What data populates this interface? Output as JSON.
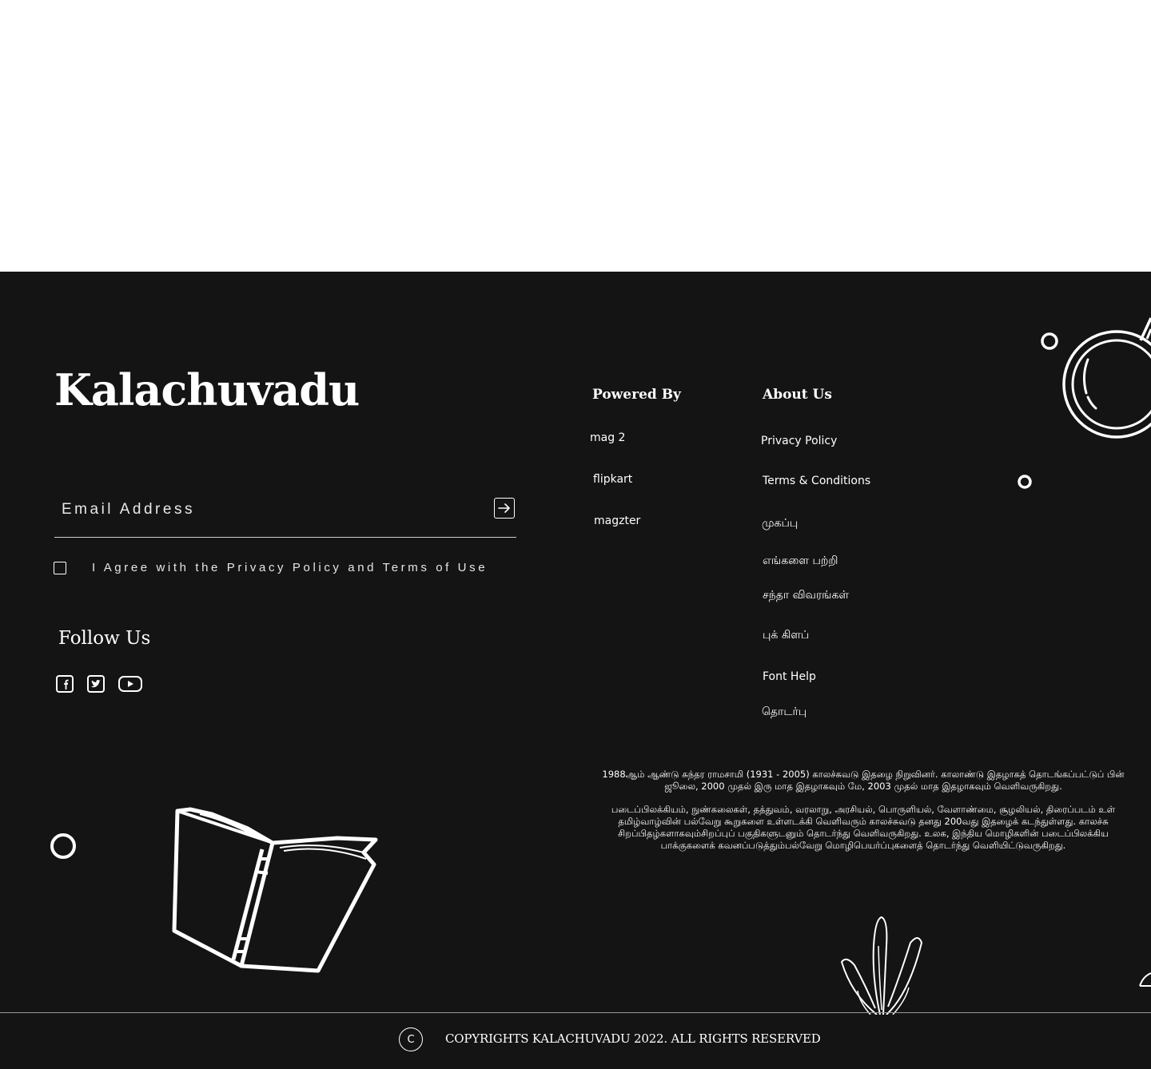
{
  "brand": {
    "name": "Kalachuvadu"
  },
  "newsletter": {
    "email_placeholder": "Email Address",
    "submit_icon": "arrow-right-square-icon",
    "agree_label": "I Agree with the Privacy Policy and Terms of Use"
  },
  "follow": {
    "title": "Follow Us",
    "icons": [
      "facebook-icon",
      "twitter-icon",
      "youtube-icon"
    ]
  },
  "powered_by": {
    "title": "Powered By",
    "links": [
      "mag 2",
      "flipkart",
      "magzter"
    ]
  },
  "about_us": {
    "title": "About Us",
    "links": [
      "Privacy Policy",
      "Terms & Conditions",
      "முகப்பு",
      "எங்களை பற்றி",
      "சந்தா விவரங்கள்",
      "புக் கிளப்",
      "Font Help",
      "தொடர்பு"
    ]
  },
  "about_text": {
    "p1_line1": "1988ஆம் ஆண்டு சுந்தர ராமசாமி (1931 - 2005) காலச்சுவடு இதழை நிறுவினர். காலாண்டு இதழாகத் தொடங்கப்பட்டுப் பின்",
    "p1_line2": "ஜூலை, 2000 முதல் இரு மாத இதழாகவும் மே, 2003 முதல் மாத இதழாகவும் வெளிவருகிறது.",
    "p2_line1": "படைப்பிலக்கியம், நுண்கலைகள், தத்துவம், வரலாறு, அரசியல், பொருளியல், வேளாண்மை, சூழலியல், திரைப்படம் உள்",
    "p2_line2": "தமிழ்வாழ்வின் பல்வேறு கூறுகளை உள்ளடக்கி வெளிவரும் காலச்சுவடு தனது 200வது இதழைக் கடந்துள்ளது. காலச்சு",
    "p2_line3": "சிறப்பிதழ்களாகவும்சிறப்புப் பகுதிகளுடனும் தொடர்ந்து வெளிவருகிறது. உலக, இந்திய மொழிகளின் படைப்பிலக்கிய",
    "p2_line4": "பாக்குகளைக் கவனப்படுத்தும்பல்வேறு மொழிபெயர்ப்புகளைத் தொடர்ந்து வெளியிட்டுவருகிறது."
  },
  "copyright": {
    "icon_glyph": "C",
    "text": "COPYRIGHTS KALACHUVADU 2022. ALL RIGHTS RESERVED"
  },
  "colors": {
    "footer_bg": "#141414",
    "text": "#ffffff",
    "page_bg": "#ffffff"
  }
}
